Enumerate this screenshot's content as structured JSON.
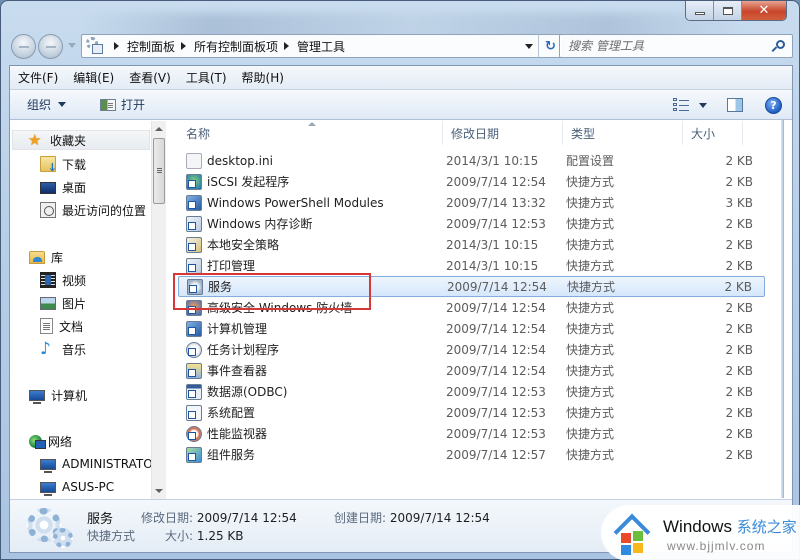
{
  "window": {
    "caption_buttons": {
      "minimize": "minimize",
      "maximize": "maximize",
      "close": "✕"
    }
  },
  "nav": {
    "back_icon": "back-arrow-icon",
    "forward_icon": "forward-arrow-icon",
    "breadcrumb": [
      "控制面板",
      "所有控制面板项",
      "管理工具"
    ],
    "refresh_glyph": "↻",
    "search_placeholder": "搜索 管理工具"
  },
  "menubar": {
    "items": [
      "文件(F)",
      "编辑(E)",
      "查看(V)",
      "工具(T)",
      "帮助(H)"
    ]
  },
  "commandbar": {
    "organize_label": "组织",
    "open_label": "打开",
    "help_glyph": "?"
  },
  "navpane": {
    "favorites": {
      "label": "收藏夹",
      "items": [
        "下载",
        "桌面",
        "最近访问的位置"
      ]
    },
    "libraries": {
      "label": "库",
      "items": [
        "视频",
        "图片",
        "文档",
        "音乐"
      ]
    },
    "computer": {
      "label": "计算机"
    },
    "network": {
      "label": "网络",
      "items": [
        "ADMINISTRATO",
        "ASUS-PC"
      ]
    }
  },
  "filelist": {
    "columns": [
      "名称",
      "修改日期",
      "类型",
      "大小"
    ],
    "selected_index": 6,
    "rows": [
      {
        "name": "desktop.ini",
        "date": "2014/3/1 10:15",
        "type": "配置设置",
        "size": "2 KB",
        "icon": "ini"
      },
      {
        "name": "iSCSI 发起程序",
        "date": "2009/7/14 12:54",
        "type": "快捷方式",
        "size": "2 KB",
        "icon": "globe"
      },
      {
        "name": "Windows PowerShell Modules",
        "date": "2009/7/14 13:32",
        "type": "快捷方式",
        "size": "3 KB",
        "icon": "ps"
      },
      {
        "name": "Windows 内存诊断",
        "date": "2009/7/14 12:53",
        "type": "快捷方式",
        "size": "2 KB",
        "icon": "mem"
      },
      {
        "name": "本地安全策略",
        "date": "2014/3/1 10:15",
        "type": "快捷方式",
        "size": "2 KB",
        "icon": "lock"
      },
      {
        "name": "打印管理",
        "date": "2014/3/1 10:15",
        "type": "快捷方式",
        "size": "2 KB",
        "icon": "print"
      },
      {
        "name": "服务",
        "date": "2009/7/14 12:54",
        "type": "快捷方式",
        "size": "2 KB",
        "icon": "gear"
      },
      {
        "name": "高级安全 Windows 防火墙",
        "date": "2009/7/14 12:54",
        "type": "快捷方式",
        "size": "2 KB",
        "icon": "fw"
      },
      {
        "name": "计算机管理",
        "date": "2009/7/14 12:54",
        "type": "快捷方式",
        "size": "2 KB",
        "icon": "ps"
      },
      {
        "name": "任务计划程序",
        "date": "2009/7/14 12:54",
        "type": "快捷方式",
        "size": "2 KB",
        "icon": "clock"
      },
      {
        "name": "事件查看器",
        "date": "2009/7/14 12:54",
        "type": "快捷方式",
        "size": "2 KB",
        "icon": "event"
      },
      {
        "name": "数据源(ODBC)",
        "date": "2009/7/14 12:53",
        "type": "快捷方式",
        "size": "2 KB",
        "icon": "db"
      },
      {
        "name": "系统配置",
        "date": "2009/7/14 12:53",
        "type": "快捷方式",
        "size": "2 KB",
        "icon": "cfg"
      },
      {
        "name": "性能监视器",
        "date": "2009/7/14 12:53",
        "type": "快捷方式",
        "size": "2 KB",
        "icon": "perf"
      },
      {
        "name": "组件服务",
        "date": "2009/7/14 12:57",
        "type": "快捷方式",
        "size": "2 KB",
        "icon": "comp"
      }
    ]
  },
  "details": {
    "name": "服务",
    "type": "快捷方式",
    "modified_label": "修改日期:",
    "modified_value": "2009/7/14 12:54",
    "created_label": "创建日期:",
    "created_value": "2009/7/14 12:54",
    "size_label": "大小:",
    "size_value": "1.25 KB"
  },
  "watermark": {
    "brand": "Windows",
    "brand_cn": "系统之家",
    "url": "www.bjjmlv.com"
  },
  "colors": {
    "highlight_box": "#d63838",
    "selection_border": "#84acdd",
    "accent": "#3b8ad8"
  }
}
